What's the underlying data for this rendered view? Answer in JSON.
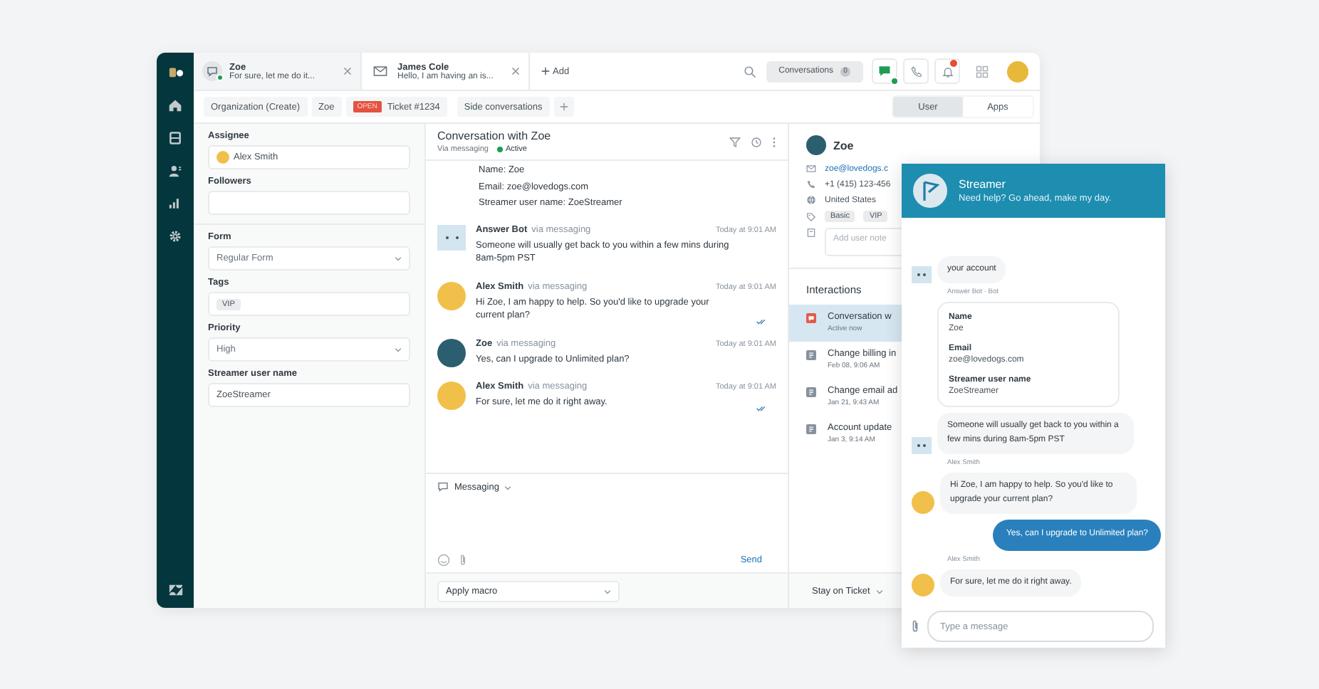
{
  "tabs": [
    {
      "title": "Zoe",
      "preview": "For sure, let me do it...",
      "kind": "chat",
      "selected": true,
      "online": true
    },
    {
      "title": "James Cole",
      "preview": "Hello, I am having an is...",
      "kind": "email",
      "selected": false,
      "online": false
    }
  ],
  "add_tab": "Add",
  "toolbar": {
    "conversations_label": "Conversations",
    "conversations_count": "0",
    "chat_online": true,
    "notifications_unread": true
  },
  "breadcrumbs": [
    {
      "label": "Organization (Create)"
    },
    {
      "label": "Zoe"
    },
    {
      "label": "Ticket #1234",
      "status": "OPEN"
    }
  ],
  "side_conversations": "Side conversations",
  "panel_switch": [
    {
      "label": "User",
      "selected": true
    },
    {
      "label": "Apps",
      "selected": false
    }
  ],
  "field_groups": [
    {
      "fields": [
        {
          "label": "Assignee",
          "kind": "person",
          "value": "Alex Smith"
        },
        {
          "label": "Followers",
          "kind": "text"
        }
      ]
    },
    {
      "fields": [
        {
          "label": "Form",
          "kind": "select",
          "value": "Regular Form"
        },
        {
          "label": "Tags",
          "kind": "tags",
          "tags": [
            "VIP"
          ]
        },
        {
          "label": "Priority",
          "kind": "select",
          "value": "High"
        },
        {
          "label": "Streamer user name",
          "kind": "text",
          "value": "ZoeStreamer"
        }
      ]
    }
  ],
  "conversation": {
    "title": "Conversation with Zoe",
    "channel": "Via messaging",
    "status": "Active",
    "active": true,
    "intro_lines": [
      "Name: Zoe",
      "Email: zoe@lovedogs.com",
      "Streamer user name: ZoeStreamer"
    ],
    "messages": [
      {
        "kind": "bot",
        "author": "Answer Bot",
        "via": "via messaging",
        "time": "Today at 9:01 AM",
        "text": "Someone will usually get back to you within a few mins during 8am-5pm PST",
        "delivered": false
      },
      {
        "kind": "agent",
        "author": "Alex Smith",
        "via": "via messaging",
        "time": "Today at 9:01 AM",
        "text": "Hi Zoe, I am happy to help. So you'd like to upgrade your current plan?",
        "delivered": true
      },
      {
        "kind": "customer",
        "author": "Zoe",
        "via": "via messaging",
        "time": "Today at 9:01 AM",
        "text": "Yes, can I upgrade to Unlimited plan?",
        "delivered": false
      },
      {
        "kind": "agent",
        "author": "Alex Smith",
        "via": "via messaging",
        "time": "Today at 9:01 AM",
        "text": "For sure, let me do it right away.",
        "delivered": true
      }
    ],
    "composer_channel": "Messaging",
    "send": "Send",
    "macro_placeholder": "Apply macro"
  },
  "user": {
    "name": "Zoe",
    "email": "zoe@lovedogs.c",
    "phone": "+1 (415) 123-456",
    "country": "United States",
    "tags": [
      "Basic",
      "VIP"
    ],
    "notes_placeholder": "Add user note"
  },
  "interactions": {
    "title": "Interactions",
    "items": [
      {
        "kind": "conversation",
        "title": "Conversation w",
        "subtitle": "Active now",
        "selected": true
      },
      {
        "kind": "ticket",
        "title": "Change billing in",
        "subtitle": "Feb 08, 9:06 AM",
        "selected": false
      },
      {
        "kind": "ticket",
        "title": "Change email ad",
        "subtitle": "Jan 21, 9:43 AM",
        "selected": false
      },
      {
        "kind": "ticket",
        "title": "Account update",
        "subtitle": "Jan 3, 9:14 AM",
        "selected": false
      }
    ]
  },
  "submit_mode": "Stay on Ticket",
  "widget": {
    "name": "Streamer",
    "tagline": "Need help? Go ahead, make my day.",
    "messages": [
      {
        "kind": "bot",
        "text": "your account"
      },
      {
        "kind": "label",
        "text": "Answer Bot · Bot"
      },
      {
        "kind": "card",
        "fields": [
          {
            "label": "Name",
            "value": "Zoe"
          },
          {
            "label": "Email",
            "value": "zoe@lovedogs.com"
          },
          {
            "label": "Streamer user name",
            "value": "ZoeStreamer"
          }
        ]
      },
      {
        "kind": "bot",
        "text": "Someone will usually get back to you within a few mins during 8am-5pm PST"
      },
      {
        "kind": "label",
        "text": "Alex Smith"
      },
      {
        "kind": "agent",
        "text": "Hi Zoe, I am happy to help. So you'd like to upgrade your current plan?"
      },
      {
        "kind": "user",
        "text": "Yes, can I upgrade to Unlimited plan?"
      },
      {
        "kind": "label",
        "text": "Alex Smith"
      },
      {
        "kind": "agent",
        "text": "For sure, let me do it right away."
      }
    ],
    "input_placeholder": "Type a message"
  }
}
